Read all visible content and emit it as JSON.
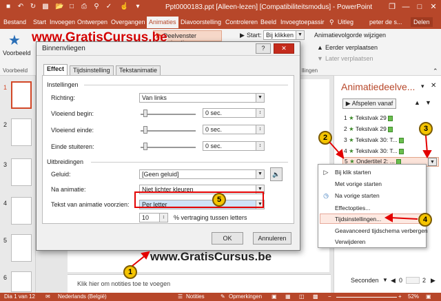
{
  "titlebar": {
    "title": "Ppt0000183.ppt [Alleen-lezen] [Compatibiliteitsmodus] - PowerPoint",
    "min": "—",
    "max": "□",
    "close": "✕",
    "restore": "❐"
  },
  "tabs": [
    "Bestand",
    "Start",
    "Invoegen",
    "Ontwerpen",
    "Overgangen",
    "Animaties",
    "Diavoorstelling",
    "Controleren",
    "Beeld",
    "Invoegtoepassir"
  ],
  "tell": "Uitleg",
  "user": "peter de s...",
  "share": "Delen",
  "ribbon": {
    "preview": "Voorbeeld",
    "preview2": "Voorbeeld",
    "pane_btn": "Deelvenster Animatie",
    "start_label": "Start:",
    "start_value": "Bij klikken",
    "reorder": "Animatievolgorde wijzigen",
    "earlier": "Eerder verplaatsen",
    "later": "Later verplaatsen",
    "timing_group": "llingen"
  },
  "watermark": "www.GratisCursus.be",
  "slides": [
    "1",
    "2",
    "3",
    "4",
    "5",
    "6"
  ],
  "canvas": {
    "bottom_text": "www.GratisCursus.be",
    "notes": "Klik hier om notities toe te voegen"
  },
  "dialog": {
    "title": "Binnenvliegen",
    "help": "?",
    "tabs": [
      "Effect",
      "Tijdsinstelling",
      "Tekstanimatie"
    ],
    "section_settings": "Instellingen",
    "direction_label": "Richting:",
    "direction_value": "Van links",
    "smooth_start": "Vloeiend begin:",
    "smooth_end": "Vloeiend einde:",
    "bounce_end": "Einde stuiteren:",
    "sec_value": "0 sec.",
    "section_ext": "Uitbreidingen",
    "sound_label": "Geluid:",
    "sound_value": "[Geen geluid]",
    "after_label": "Na animatie:",
    "after_value": "Niet lichter kleuren",
    "text_label": "Tekst van animatie voorzien:",
    "text_value": "Per letter",
    "delay_value": "10",
    "delay_label": "% vertraging tussen letters",
    "ok": "OK",
    "cancel": "Annuleren"
  },
  "anipane": {
    "title": "Animatiedeelve...",
    "play": "Afspelen vanaf",
    "items": [
      {
        "num": "1",
        "label": "Tekstvak 29"
      },
      {
        "num": "2",
        "label": "Tekstvak 29"
      },
      {
        "num": "3",
        "label": "Tekstvak 30: T..."
      },
      {
        "num": "4",
        "label": "Tekstvak 30: T..."
      },
      {
        "num": "5",
        "label": "Ondertitel 2: ..."
      }
    ],
    "seconds": "Seconden",
    "zoom_start": "0",
    "zoom_end": "2"
  },
  "context_menu": [
    "Bij klik starten",
    "Met vorige starten",
    "Na vorige starten",
    "Effectopties...",
    "Tijdsinstellingen...",
    "Geavanceerd tijdschema verbergen",
    "Verwijderen"
  ],
  "markers": [
    "1",
    "2",
    "3",
    "4",
    "5"
  ],
  "status": {
    "slide": "Dia 1 van 12",
    "lang": "Nederlands (België)",
    "notes": "Notities",
    "comments": "Opmerkingen",
    "zoom": "52%"
  },
  "colors": {
    "accent": "#b7472a",
    "marker": "#f5c400",
    "highlight": "#e30000"
  }
}
